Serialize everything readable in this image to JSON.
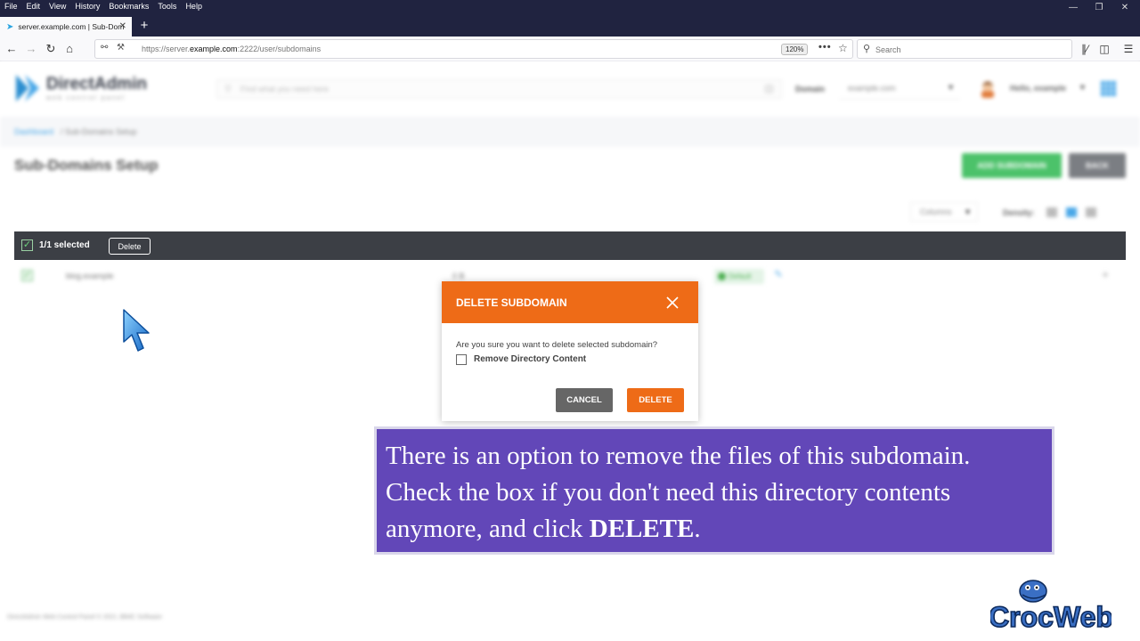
{
  "browser": {
    "menu": [
      "File",
      "Edit",
      "View",
      "History",
      "Bookmarks",
      "Tools",
      "Help"
    ],
    "tab_title": "server.example.com | Sub-Dom",
    "url_prefix": "https://server.",
    "url_host": "example.com",
    "url_path": ":2222/user/subdomains",
    "zoom": "120%",
    "search_placeholder": "Search"
  },
  "header": {
    "logo_name": "DirectAdmin",
    "logo_sub": "web control panel",
    "search_placeholder": "Find what you need here",
    "domain_label": "Domain",
    "domain_value": "example.com",
    "user_greeting": "Hello, example"
  },
  "breadcrumb": {
    "home": "Dashboard",
    "current": "/ Sub-Domains Setup"
  },
  "page": {
    "title": "Sub-Domains Setup",
    "add_button": "ADD SUBDOMAIN",
    "back_button": "BACK",
    "columns_label": "Columns",
    "density_label": "Density:"
  },
  "selection": {
    "text": "1/1 selected",
    "delete_label": "Delete"
  },
  "table": {
    "rows": [
      {
        "name": "blog.example",
        "size": "0 B",
        "status": "Default"
      }
    ]
  },
  "dialog": {
    "title": "DELETE SUBDOMAIN",
    "message": "Are you sure you want to delete selected subdomain?",
    "checkbox_label": "Remove Directory Content",
    "cancel_label": "CANCEL",
    "delete_label": "DELETE"
  },
  "caption": {
    "line1": "There is an option to remove the files of this subdomain.",
    "line2": "Check the box if you don't need this directory contents",
    "line3_prefix": "anymore, and click ",
    "line3_bold": "DELETE",
    "line3_suffix": "."
  },
  "footer": {
    "text": "DirectAdmin Web Control Panel © 2021 JBMC Software"
  },
  "watermark": {
    "text": "CrocWeb"
  },
  "colors": {
    "accent_orange": "#ee6b17",
    "selection_bar": "#3c3f45",
    "caption_bg": "#6247b8",
    "success_green": "#4cc26a",
    "link_blue": "#4aa8e8"
  }
}
